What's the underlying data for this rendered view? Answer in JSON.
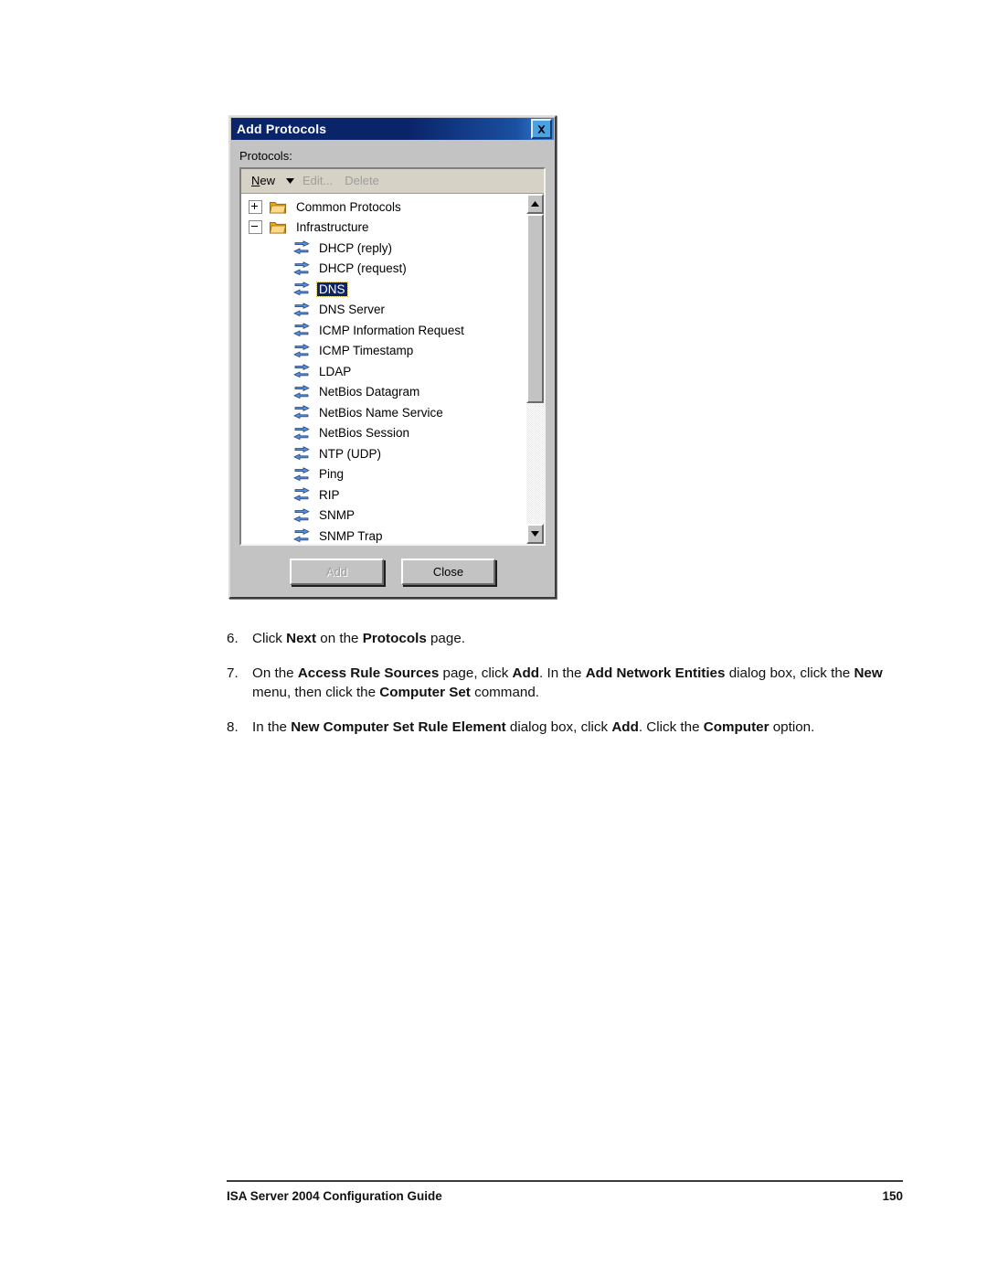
{
  "dialog": {
    "title": "Add Protocols",
    "close_icon": "close-icon",
    "protocols_label": "Protocols:",
    "toolbar": {
      "new_label": "New",
      "new_accel": "N",
      "new_rest": "ew",
      "dropdown_icon": "chevron-down-icon",
      "edit_label": "Edit...",
      "delete_label": "Delete"
    },
    "tree": [
      {
        "label": "Common Protocols",
        "type": "folder",
        "expander": "plus",
        "selected": false
      },
      {
        "label": "Infrastructure",
        "type": "folder",
        "expander": "minus",
        "selected": false
      },
      {
        "label": "DHCP (reply)",
        "type": "protocol",
        "selected": false
      },
      {
        "label": "DHCP (request)",
        "type": "protocol",
        "selected": false
      },
      {
        "label": "DNS",
        "type": "protocol",
        "selected": true
      },
      {
        "label": "DNS Server",
        "type": "protocol",
        "selected": false
      },
      {
        "label": "ICMP Information Request",
        "type": "protocol",
        "selected": false
      },
      {
        "label": "ICMP Timestamp",
        "type": "protocol",
        "selected": false
      },
      {
        "label": "LDAP",
        "type": "protocol",
        "selected": false
      },
      {
        "label": "NetBios Datagram",
        "type": "protocol",
        "selected": false
      },
      {
        "label": "NetBios Name Service",
        "type": "protocol",
        "selected": false
      },
      {
        "label": "NetBios Session",
        "type": "protocol",
        "selected": false
      },
      {
        "label": "NTP (UDP)",
        "type": "protocol",
        "selected": false
      },
      {
        "label": "Ping",
        "type": "protocol",
        "selected": false
      },
      {
        "label": "RIP",
        "type": "protocol",
        "selected": false
      },
      {
        "label": "SNMP",
        "type": "protocol",
        "selected": false
      },
      {
        "label": "SNMP Trap",
        "type": "protocol",
        "selected": false
      }
    ],
    "scrollbar": {
      "up_icon": "scroll-up-arrow-icon",
      "down_icon": "scroll-down-arrow-icon",
      "thumb_percent": 61
    },
    "buttons": {
      "add_label": "Add",
      "add_enabled": false,
      "close_label": "Close",
      "close_enabled": true
    },
    "colors": {
      "titlebar": "#0A246A",
      "selection": "#0A246A",
      "face": "#C3C3C3",
      "toolbar": "#D6D2C6",
      "protocol_icon": "#3B6FC4",
      "folder_icon": "#F0C040"
    }
  },
  "steps": [
    {
      "num": "6.",
      "parts": [
        {
          "t": "Click ",
          "b": false
        },
        {
          "t": "Next",
          "b": true
        },
        {
          "t": " on the ",
          "b": false
        },
        {
          "t": "Protocols",
          "b": true
        },
        {
          "t": " page.",
          "b": false
        }
      ]
    },
    {
      "num": "7.",
      "parts": [
        {
          "t": "On the ",
          "b": false
        },
        {
          "t": "Access Rule Sources",
          "b": true
        },
        {
          "t": " page, click ",
          "b": false
        },
        {
          "t": "Add",
          "b": true
        },
        {
          "t": ". In the ",
          "b": false
        },
        {
          "t": "Add Network Entities",
          "b": true
        },
        {
          "t": " dialog box, click the ",
          "b": false
        },
        {
          "t": "New",
          "b": true
        },
        {
          "t": " menu, then click the ",
          "b": false
        },
        {
          "t": "Computer Set",
          "b": true
        },
        {
          "t": " command.",
          "b": false
        }
      ]
    },
    {
      "num": "8.",
      "parts": [
        {
          "t": "In the ",
          "b": false
        },
        {
          "t": "New Computer Set Rule Element",
          "b": true
        },
        {
          "t": " dialog box, click ",
          "b": false
        },
        {
          "t": "Add",
          "b": true
        },
        {
          "t": ". Click the ",
          "b": false
        },
        {
          "t": "Computer",
          "b": true
        },
        {
          "t": " option.",
          "b": false
        }
      ]
    }
  ],
  "footer": {
    "guide_title": "ISA Server 2004 Configuration Guide",
    "page_number": "150"
  }
}
